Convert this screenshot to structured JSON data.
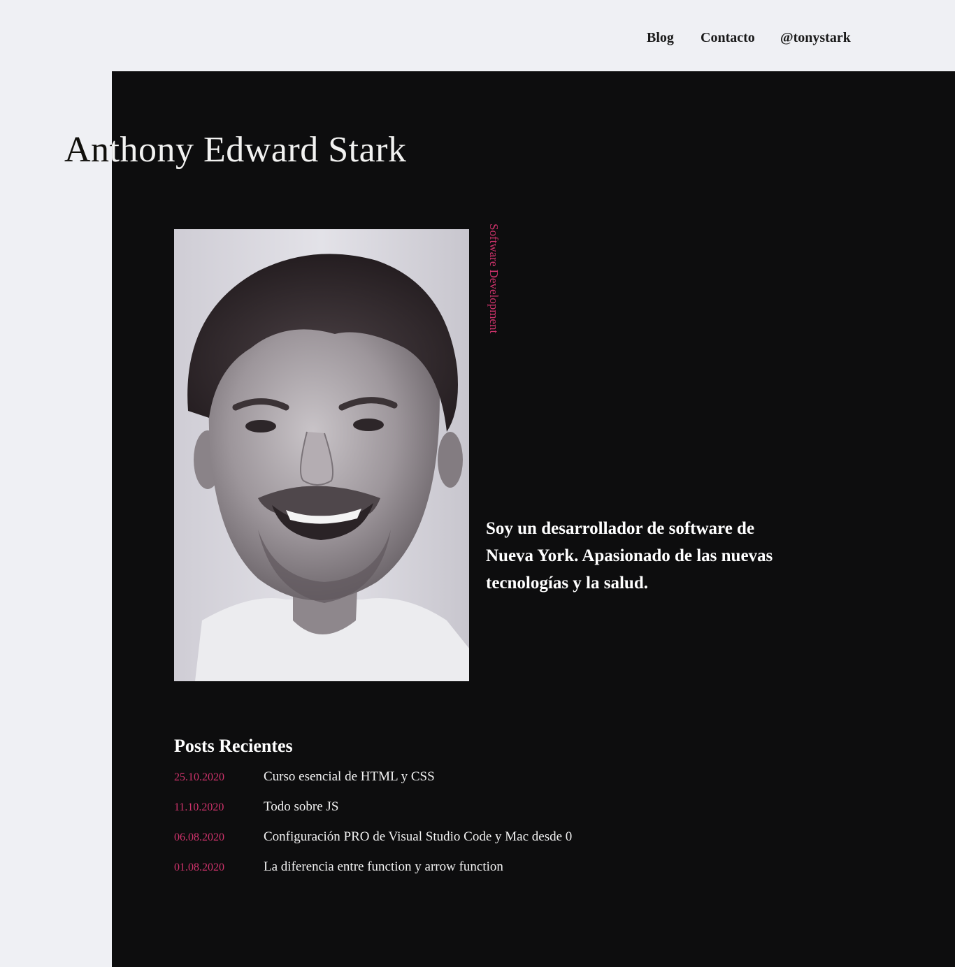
{
  "nav": {
    "items": [
      {
        "label": "Blog"
      },
      {
        "label": "Contacto"
      },
      {
        "label": "@tonystark"
      }
    ]
  },
  "hero": {
    "name": "Anthony Edward Stark",
    "role": "Software Development",
    "bio": "Soy un desarrollador de software de Nueva York. Apasionado de las nuevas tecnologías y la salud.",
    "photo_icon": "portrait-photo"
  },
  "posts": {
    "title": "Posts Recientes",
    "items": [
      {
        "date": "25.10.2020",
        "title": "Curso esencial de HTML y CSS"
      },
      {
        "date": "11.10.2020",
        "title": "Todo sobre JS"
      },
      {
        "date": "06.08.2020",
        "title": "Configuración PRO de Visual Studio Code y Mac desde 0"
      },
      {
        "date": "01.08.2020",
        "title": "La diferencia entre function y arrow function"
      }
    ]
  },
  "colors": {
    "background": "#eff0f4",
    "panel": "#0d0d0e",
    "accent": "#d0336c",
    "text_light": "#ffffff"
  }
}
